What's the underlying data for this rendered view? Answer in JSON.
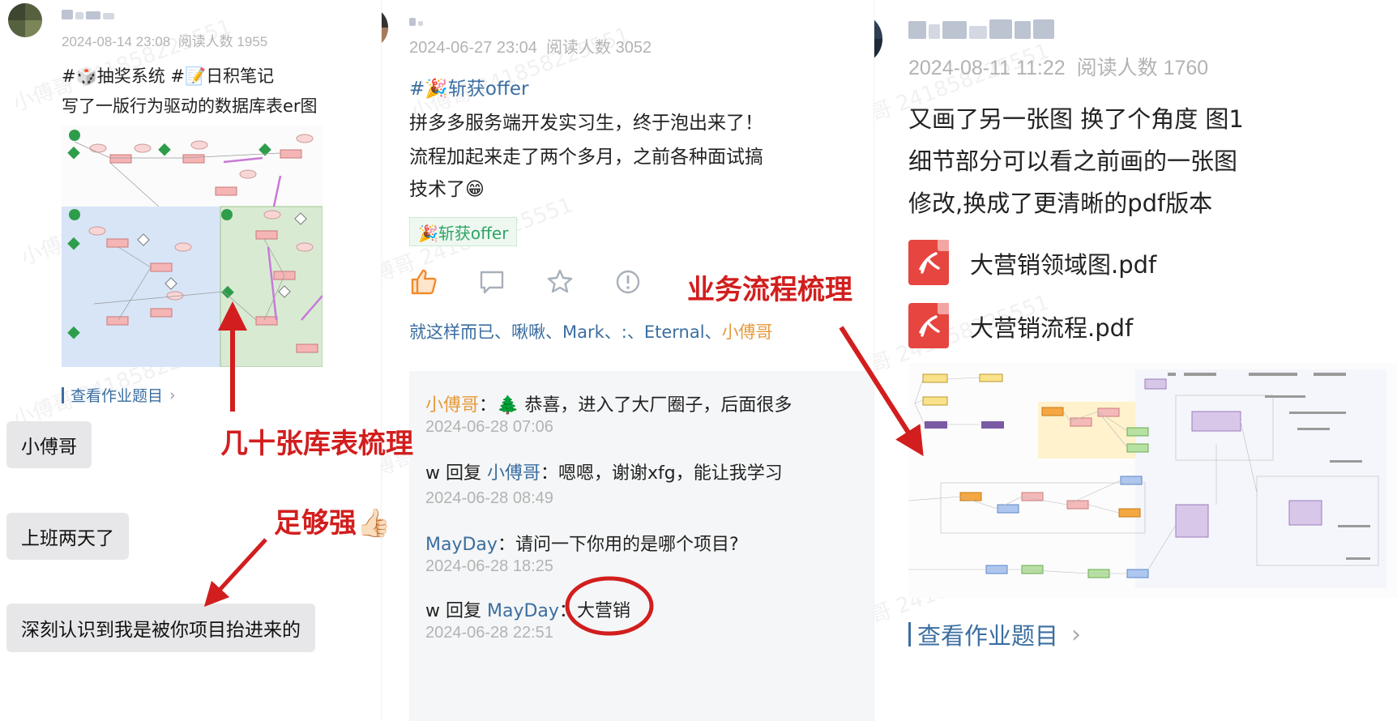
{
  "left_post": {
    "date": "2024-08-14 23:08",
    "views_label": "阅读人数",
    "views": "1955",
    "topic_line": "#🎲抽奖系统  #📝日积笔记",
    "body": "写了一版行为驱动的数据库表er图",
    "homework_link": "查看作业题目",
    "chat": [
      "小傅哥",
      "上班两天了",
      "深刻认识到我是被你项目抬进来的"
    ]
  },
  "mid_post": {
    "date": "2024-06-27 23:04",
    "views_label": "阅读人数",
    "views": "3052",
    "topic": "#🎉斩获offer",
    "body_lines": [
      "拼多多服务端开发实习生，终于泡出来了！",
      "流程加起来走了两个多月，之前各种面试搞",
      "技术了😁"
    ],
    "tag": "🎉斩获offer",
    "likers_prefix": "就这样而已、啾啾、Mark、:、Eternal、",
    "likers_highlight": "小傅哥",
    "comments": [
      {
        "name": "小傅哥",
        "text": "🌲 恭喜，进入了大厂圈子，后面很多",
        "time": "2024-06-28 07:06"
      },
      {
        "prefix": "w 回复 ",
        "name": "小傅哥",
        "text": "嗯嗯，谢谢xfg，能让我学习",
        "time": "2024-06-28 08:49"
      },
      {
        "name": "MayDay",
        "text": "请问一下你用的是哪个项目?",
        "time": "2024-06-28 18:25"
      },
      {
        "prefix": "w 回复 ",
        "name": "MayDay",
        "text": "大营销",
        "time": "2024-06-28 22:51"
      }
    ]
  },
  "right_post": {
    "date": "2024-08-11 11:22",
    "views_label": "阅读人数",
    "views": "1760",
    "body_lines": [
      "又画了另一张图 换了个角度 图1",
      "细节部分可以看之前画的一张图",
      "修改,换成了更清晰的pdf版本"
    ],
    "files": [
      "大营销领域图.pdf",
      "大营销流程.pdf"
    ],
    "homework_link": "查看作业题目"
  },
  "annotations": {
    "tables": "几十张库表梳理",
    "strong": "足够强👍🏻",
    "flow": "业务流程梳理"
  },
  "watermark": "小傅哥 241858225551"
}
